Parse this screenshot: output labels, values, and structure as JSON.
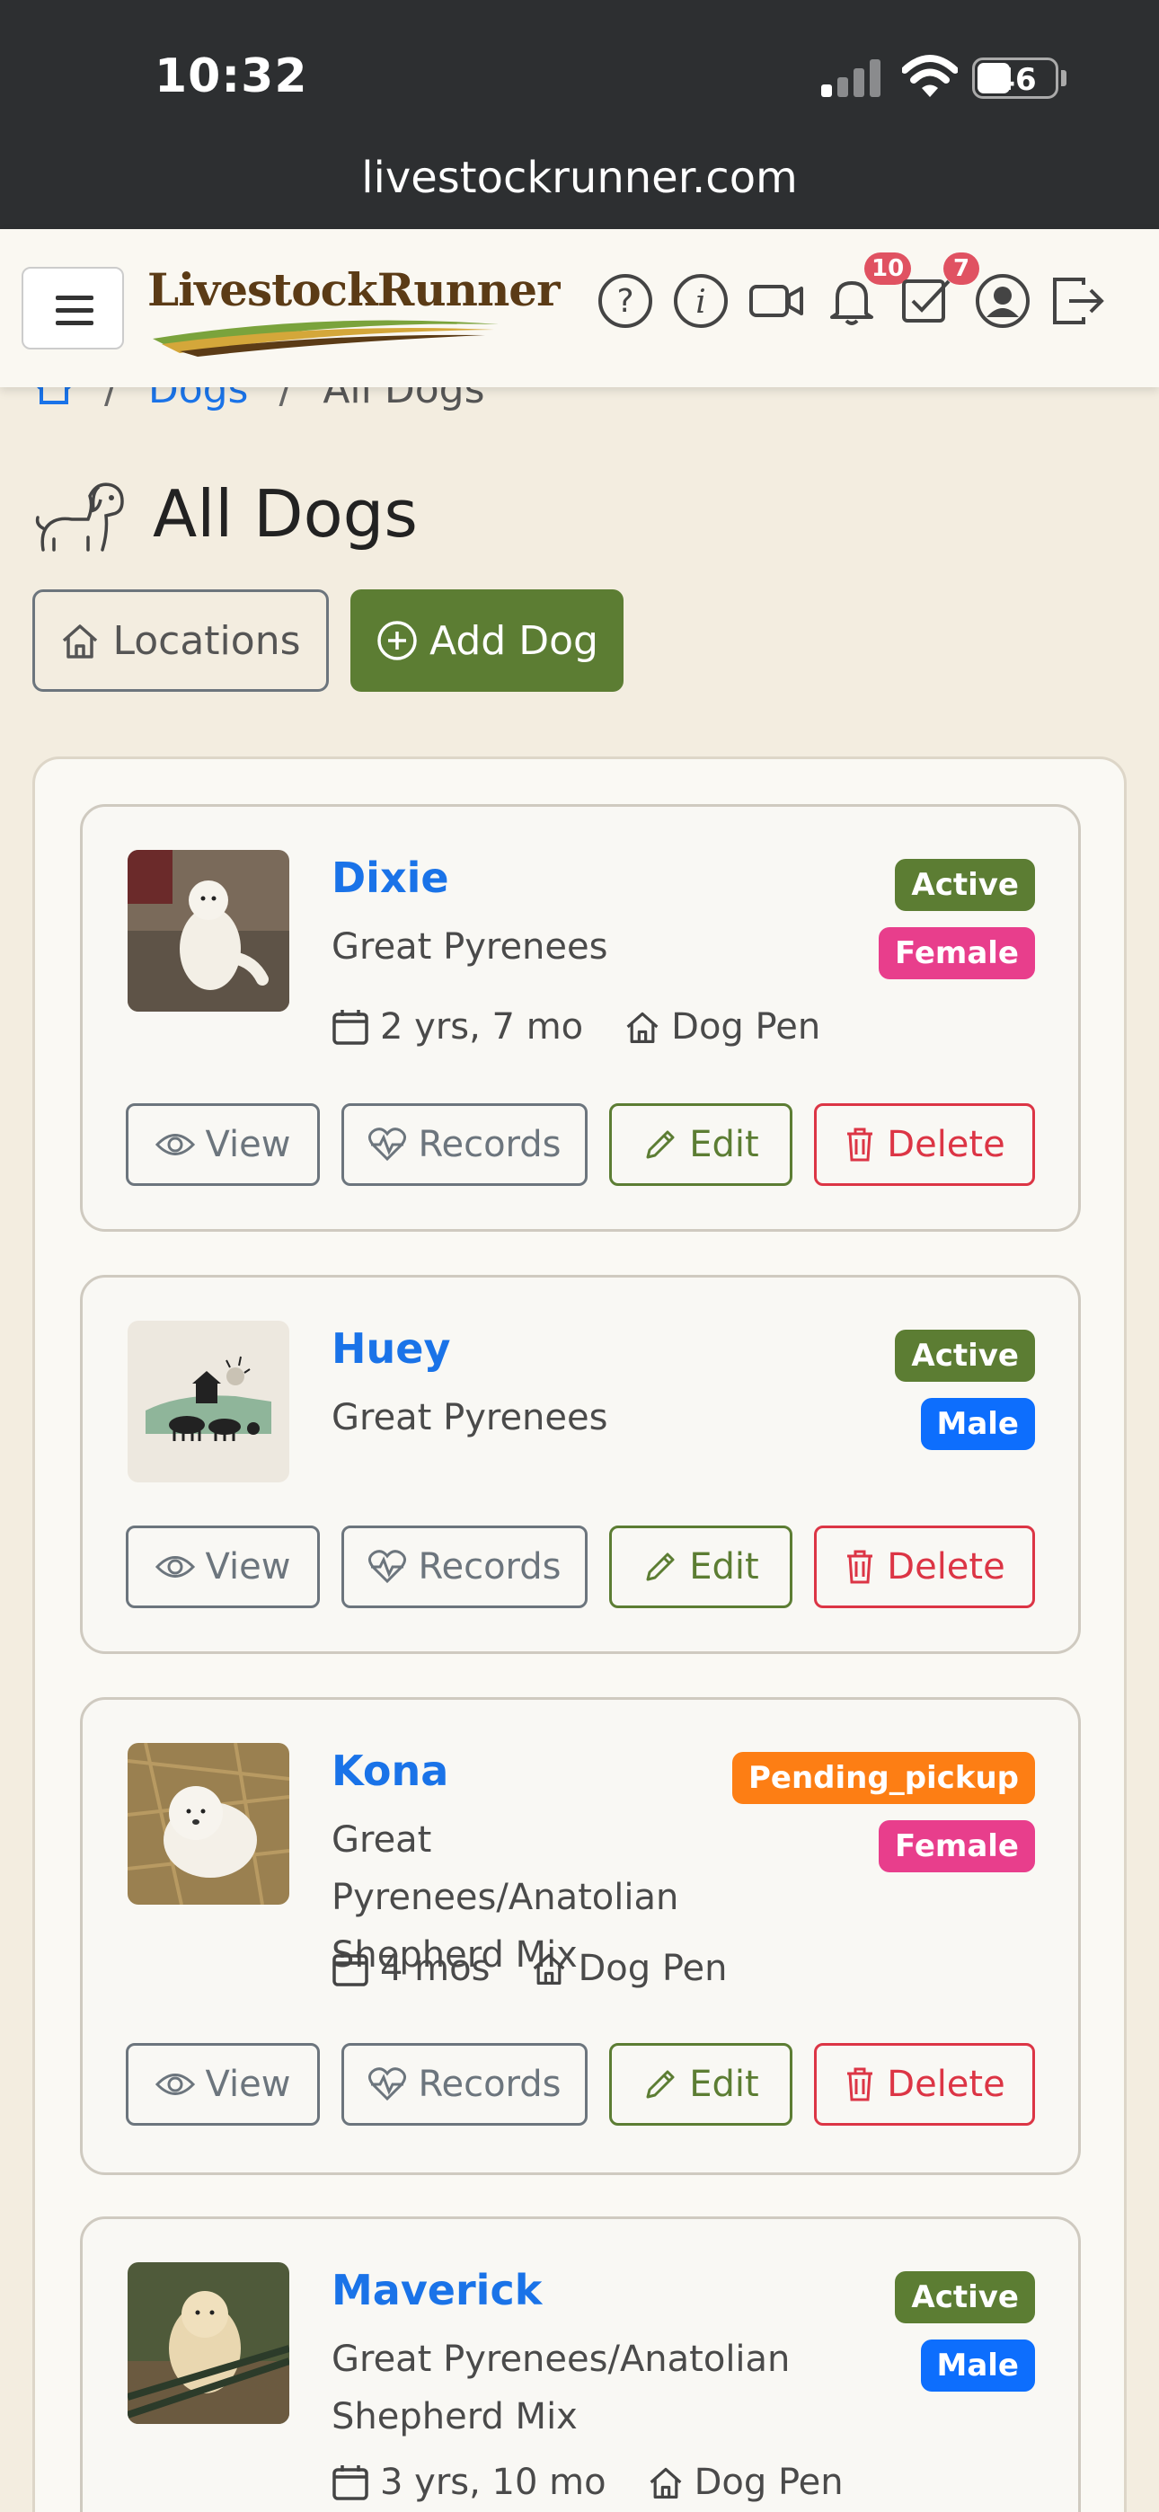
{
  "status_bar": {
    "time": "10:32",
    "battery": "46",
    "url": "livestockrunner.com"
  },
  "header": {
    "logo_text": "LivestockRunner",
    "notifications_count": "10",
    "tasks_count": "7"
  },
  "breadcrumb": {
    "section": "Dogs",
    "current": "All Dogs"
  },
  "page": {
    "title": "All Dogs"
  },
  "buttons": {
    "locations": "Locations",
    "add_dog": "Add Dog"
  },
  "action_labels": {
    "view": "View",
    "records": "Records",
    "edit": "Edit",
    "delete": "Delete"
  },
  "dogs": [
    {
      "name": "Dixie",
      "breed": "Great Pyrenees",
      "status": "Active",
      "sex": "Female",
      "age": "2 yrs, 7 mo",
      "location": "Dog Pen"
    },
    {
      "name": "Huey",
      "breed": "Great Pyrenees",
      "status": "Active",
      "sex": "Male"
    },
    {
      "name": "Kona",
      "breed": "Great Pyrenees/Anatolian Shepherd Mix",
      "status": "Pending_pickup",
      "sex": "Female",
      "age": "4 mos",
      "location": "Dog Pen"
    },
    {
      "name": "Maverick",
      "breed": "Great Pyrenees/Anatolian Shepherd Mix",
      "status": "Active",
      "sex": "Male",
      "age": "3 yrs, 10 mo",
      "location": "Dog Pen"
    }
  ],
  "colors": {
    "active": "#5c7d33",
    "pending": "#fd7e14",
    "female": "#e83e8c",
    "male": "#0d6efd",
    "link": "#1a73e8"
  }
}
